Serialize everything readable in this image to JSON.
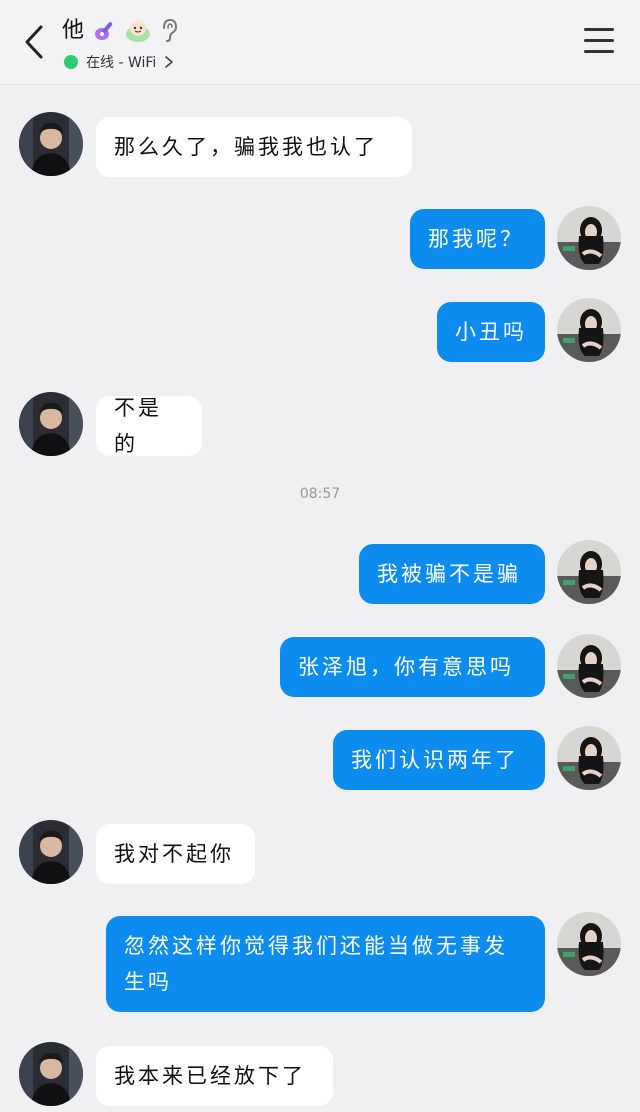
{
  "header": {
    "contact_name": "他",
    "status_text": "在线 - WiFi",
    "status_color": "#2ecc71",
    "badges": [
      "guitar-icon",
      "smiley-icon",
      "ear-icon"
    ]
  },
  "colors": {
    "outgoing_bubble": "#0d8cf0",
    "incoming_bubble": "#ffffff",
    "background": "#f0f0f2"
  },
  "timestamp": "08:57",
  "messages": [
    {
      "side": "in",
      "text": "那么久了，骗我我也认了"
    },
    {
      "side": "out",
      "text": "那我呢？"
    },
    {
      "side": "out",
      "text": "小丑吗"
    },
    {
      "side": "in",
      "text": "不是的"
    },
    {
      "side": "out",
      "text": "我被骗不是骗"
    },
    {
      "side": "out",
      "text": "张泽旭，你有意思吗"
    },
    {
      "side": "out",
      "text": "我们认识两年了"
    },
    {
      "side": "in",
      "text": "我对不起你"
    },
    {
      "side": "out",
      "text": "忽然这样你觉得我们还能当做无事发生吗"
    },
    {
      "side": "in",
      "text": "我本来已经放下了"
    }
  ]
}
